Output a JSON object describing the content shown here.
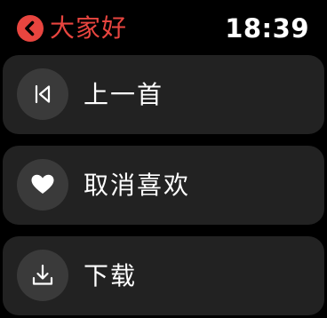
{
  "header": {
    "back_label": "大家好",
    "time": "18:39"
  },
  "menu": {
    "items": [
      {
        "label": "上一首",
        "icon": "previous-track-icon"
      },
      {
        "label": "取消喜欢",
        "icon": "heart-icon"
      },
      {
        "label": "下载",
        "icon": "download-icon"
      }
    ]
  },
  "colors": {
    "accent": "#e8453f",
    "background": "#000000",
    "card": "#222222",
    "icon_circle": "#3a3a3a",
    "text": "#ffffff"
  }
}
